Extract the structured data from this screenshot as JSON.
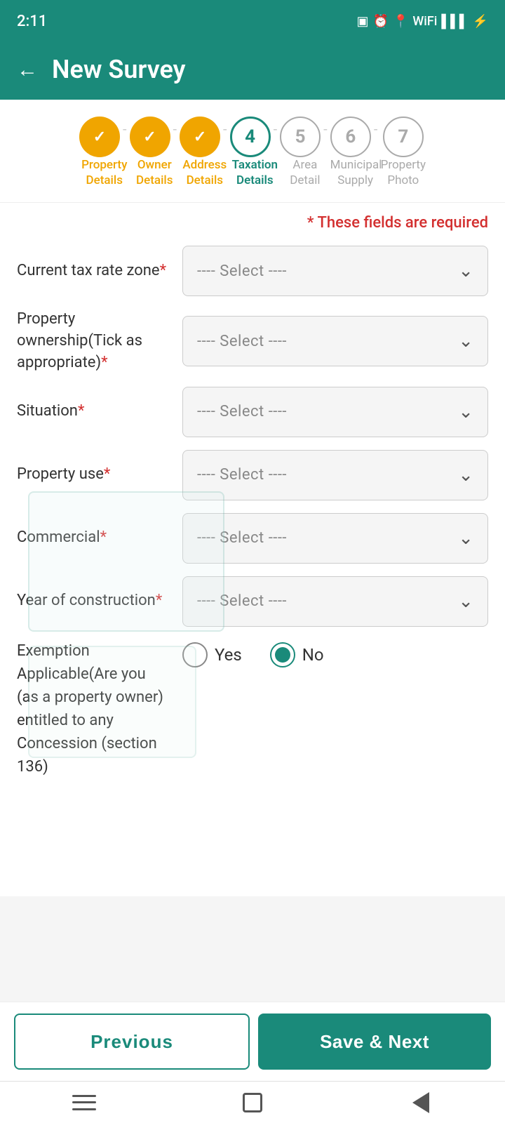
{
  "statusBar": {
    "time": "2:11",
    "icons": [
      "download",
      "fan",
      "usb",
      "vibrate",
      "alarm",
      "location",
      "wifi",
      "data",
      "signal1",
      "signal2",
      "battery"
    ]
  },
  "header": {
    "title": "New Survey",
    "back_label": "←"
  },
  "steps": [
    {
      "id": 1,
      "label": "Property\nDetails",
      "state": "completed",
      "display": "✓"
    },
    {
      "id": 2,
      "label": "Owner\nDetails",
      "state": "completed",
      "display": "✓"
    },
    {
      "id": 3,
      "label": "Address\nDetails",
      "state": "completed",
      "display": "✓"
    },
    {
      "id": 4,
      "label": "Taxation\nDetails",
      "state": "active",
      "display": "4"
    },
    {
      "id": 5,
      "label": "Area\nDetail",
      "state": "inactive",
      "display": "5"
    },
    {
      "id": 6,
      "label": "Municipal\nSupply",
      "state": "inactive",
      "display": "6"
    },
    {
      "id": 7,
      "label": "Property\nPhoto",
      "state": "inactive",
      "display": "7"
    }
  ],
  "requiredNotice": "* These fields are required",
  "form": {
    "fields": [
      {
        "id": "tax_rate_zone",
        "label": "Current tax rate zone",
        "required": true,
        "placeholder": "---- Select ----",
        "type": "select"
      },
      {
        "id": "property_ownership",
        "label": "Property ownership(Tick as appropriate)",
        "required": true,
        "placeholder": "---- Select ----",
        "type": "select"
      },
      {
        "id": "situation",
        "label": "Situation",
        "required": true,
        "placeholder": "---- Select ----",
        "type": "select"
      },
      {
        "id": "property_use",
        "label": "Property use",
        "required": true,
        "placeholder": "---- Select ----",
        "type": "select"
      },
      {
        "id": "commercial",
        "label": "Commercial",
        "required": true,
        "placeholder": "---- Select ----",
        "type": "select"
      },
      {
        "id": "year_of_construction",
        "label": "Year of construction",
        "required": true,
        "placeholder": "---- Select ----",
        "type": "select"
      }
    ],
    "exemption": {
      "label": "Exemption Applicable(Are you (as a property owner) entitled to any Concession (section 136)",
      "options": [
        {
          "value": "yes",
          "label": "Yes",
          "selected": false
        },
        {
          "value": "no",
          "label": "No",
          "selected": true
        }
      ]
    }
  },
  "buttons": {
    "previous": "Previous",
    "saveNext": "Save & Next"
  },
  "chevron": "⌵",
  "checkmark": "✓"
}
